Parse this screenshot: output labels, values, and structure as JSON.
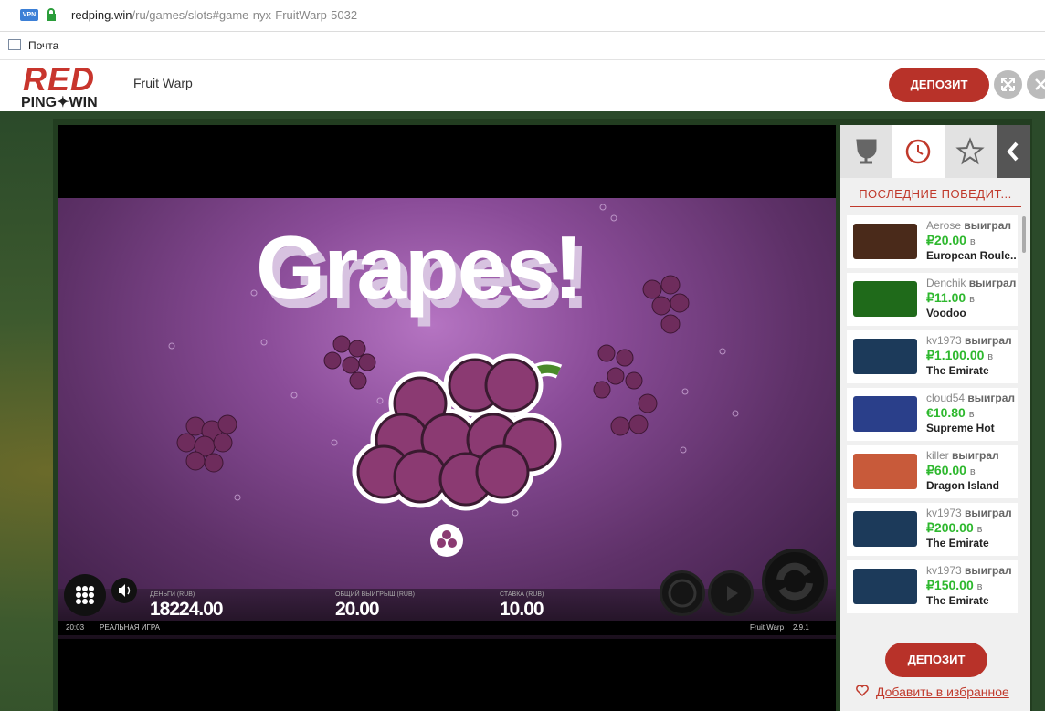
{
  "browser": {
    "vpn_label": "VPN",
    "url_domain": "redping.win",
    "url_path": "/ru/games/slots#game-nyx-FruitWarp-5032",
    "bookmark_label": "Почта"
  },
  "header": {
    "logo_top": "RED",
    "logo_bottom": "PING✦WIN",
    "game_title": "Fruit Warp",
    "deposit_label": "ДЕПОЗИТ"
  },
  "game": {
    "banner": "Grapes!",
    "money_label": "ДЕНЬГИ (RUB)",
    "money_value": "18224.00",
    "total_win_label": "ОБЩИЙ ВЫИГРЫШ (RUB)",
    "total_win_value": "20.00",
    "bet_label": "СТАВКА (RUB)",
    "bet_value": "10.00",
    "clock": "20:03",
    "mode": "РЕАЛЬНАЯ ИГРА",
    "game_name": "Fruit Warp",
    "version": "2.9.1"
  },
  "sidebar": {
    "title": "ПОСЛЕДНИЕ ПОБЕДИТ...",
    "verb": "выиграл",
    "in": "в",
    "winners": [
      {
        "user": "Aerose",
        "amount": "₽20.00",
        "game": "European Roule...",
        "thumb": "#4a2a1a"
      },
      {
        "user": "Denchik",
        "amount": "₽11.00",
        "game": "Voodoo",
        "thumb": "#1f6a1a"
      },
      {
        "user": "kv1973",
        "amount": "₽1.100.00",
        "game": "The Emirate",
        "thumb": "#1c3a5a"
      },
      {
        "user": "cloud54",
        "amount": "€10.80",
        "game": "Supreme Hot",
        "thumb": "#2a3f8a"
      },
      {
        "user": "killer",
        "amount": "₽60.00",
        "game": "Dragon Island",
        "thumb": "#c85a3a"
      },
      {
        "user": "kv1973",
        "amount": "₽200.00",
        "game": "The Emirate",
        "thumb": "#1c3a5a"
      },
      {
        "user": "kv1973",
        "amount": "₽150.00",
        "game": "The Emirate",
        "thumb": "#1c3a5a"
      }
    ],
    "deposit_label": "ДЕПОЗИТ",
    "favorite_label": "Добавить в избранное"
  }
}
